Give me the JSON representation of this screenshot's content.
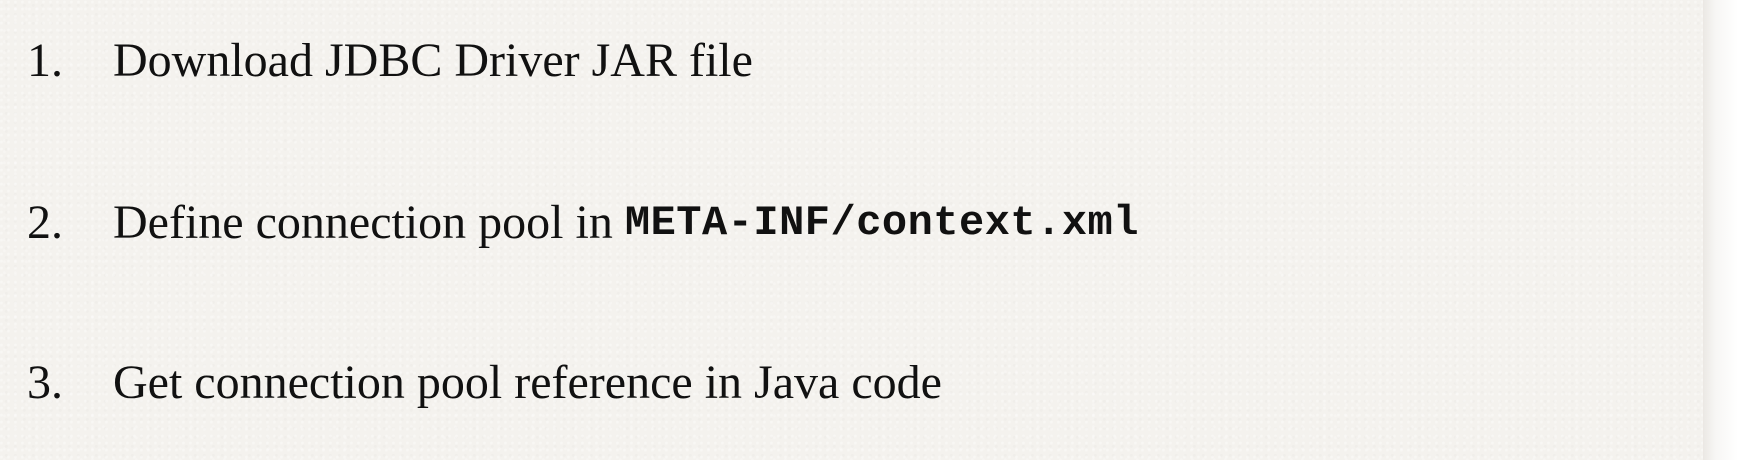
{
  "slide": {
    "steps": [
      {
        "number": "1.",
        "text": "Download JDBC Driver JAR file"
      },
      {
        "number": "2.",
        "text": "Define connection pool in",
        "code": "META-INF/context.xml"
      },
      {
        "number": "3.",
        "text": "Get connection pool reference in Java code"
      }
    ]
  }
}
